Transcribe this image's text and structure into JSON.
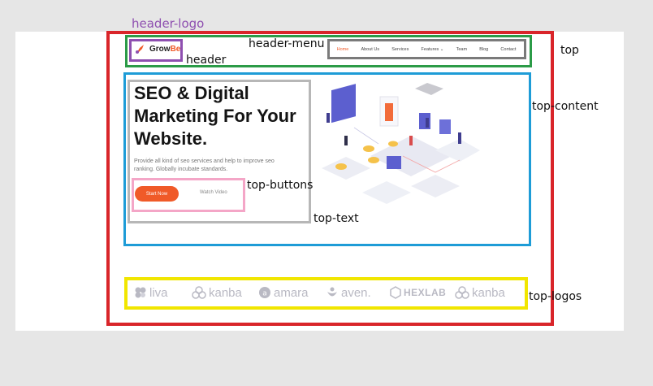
{
  "annotations": {
    "header_logo": "header-logo",
    "header": "header",
    "header_menu": "header-menu",
    "top": "top",
    "top_content": "top-content",
    "top_buttons": "top-buttons",
    "top_text": "top-text",
    "top_logos": "top-logos"
  },
  "colors": {
    "top": "#d9252a",
    "header": "#2b9b47",
    "header_logo": "#8e4fb0",
    "header_menu": "#7a7a7a",
    "top_content": "#1e9cd7",
    "top_text": "#b7b7b7",
    "top_buttons": "#f4a6c7",
    "top_logos": "#f1e600",
    "brand_accent": "#f05a28"
  },
  "brand": {
    "name_prefix": "Grow",
    "name_suffix": "Be",
    "icon": "rocket-icon"
  },
  "menu": [
    {
      "label": "Home",
      "active": true
    },
    {
      "label": "About Us",
      "active": false
    },
    {
      "label": "Services",
      "active": false
    },
    {
      "label": "Features ⌄",
      "active": false
    },
    {
      "label": "Team",
      "active": false
    },
    {
      "label": "Blog",
      "active": false
    },
    {
      "label": "Contact",
      "active": false
    }
  ],
  "hero": {
    "title": "SEO & Digital Marketing For Your Website.",
    "description": "Provide all kind of seo services and help to improve seo ranking. Globally incubate standards.",
    "primary_button": "Start Now",
    "secondary_button": "Watch Video"
  },
  "partners": [
    {
      "name": "liva",
      "icon": "flower-icon"
    },
    {
      "name": "kanba",
      "icon": "rings-icon"
    },
    {
      "name": "amara",
      "icon": "circle-a-icon"
    },
    {
      "name": "aven.",
      "icon": "person-icon"
    },
    {
      "name": "HEXLAB",
      "icon": "hexagon-icon"
    },
    {
      "name": "kanba",
      "icon": "rings-icon"
    }
  ]
}
